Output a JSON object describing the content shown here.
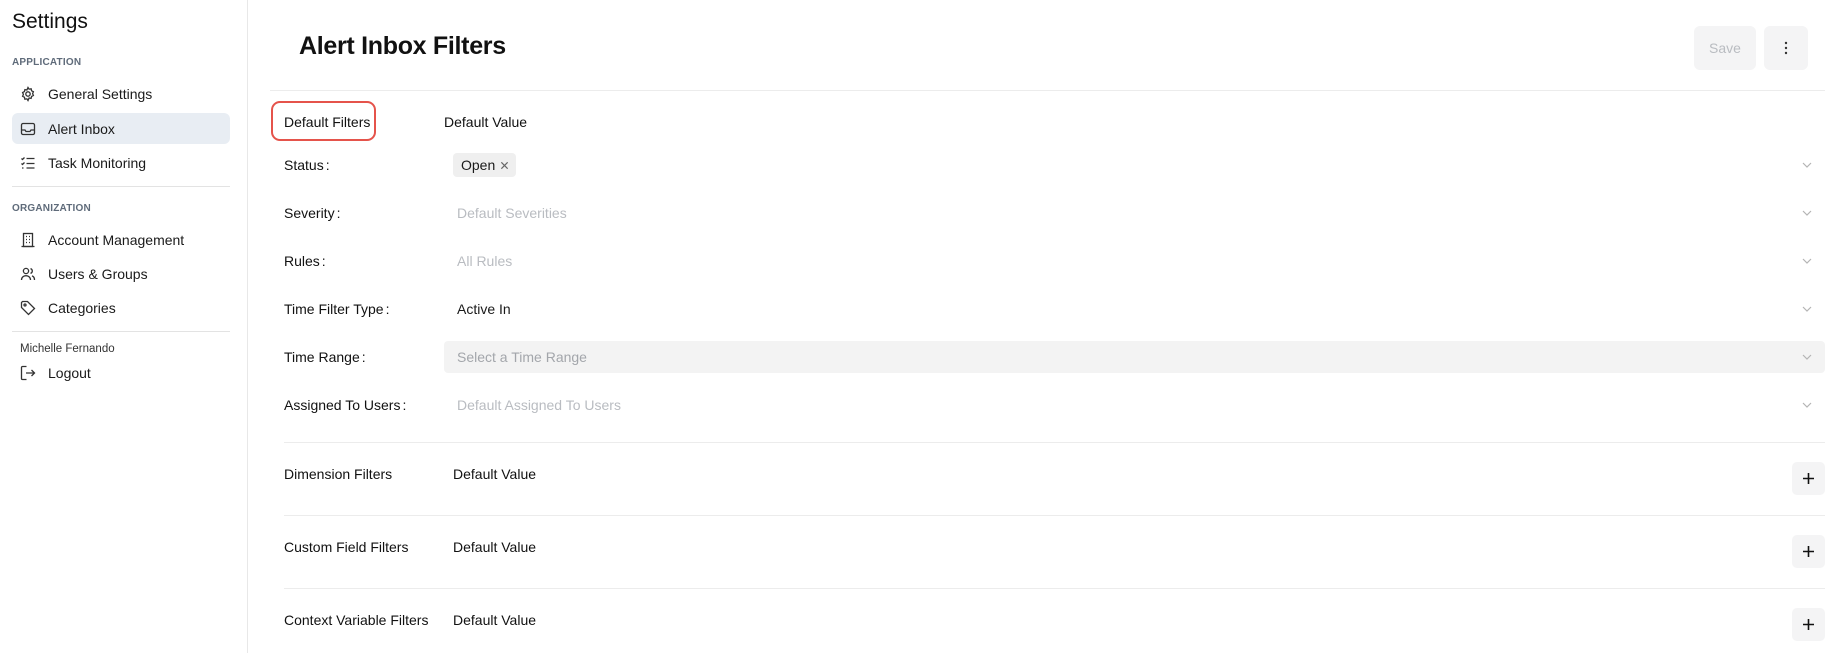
{
  "sidebar": {
    "title": "Settings",
    "sections": [
      {
        "label": "APPLICATION"
      },
      {
        "label": "ORGANIZATION"
      }
    ],
    "application_items": [
      {
        "label": "General Settings",
        "icon": "gear-icon"
      },
      {
        "label": "Alert Inbox",
        "icon": "inbox-icon",
        "active": true
      },
      {
        "label": "Task Monitoring",
        "icon": "list-check-icon"
      }
    ],
    "organization_items": [
      {
        "label": "Account Management",
        "icon": "building-icon"
      },
      {
        "label": "Users & Groups",
        "icon": "users-icon"
      },
      {
        "label": "Categories",
        "icon": "tag-icon"
      }
    ],
    "user_name": "Michelle Fernando",
    "logout_label": "Logout"
  },
  "header": {
    "title": "Alert Inbox Filters",
    "save_label": "Save"
  },
  "default_filters": {
    "heading": "Default Filters",
    "value_heading": "Default Value",
    "rows": [
      {
        "label": "Status",
        "tag": "Open"
      },
      {
        "label": "Severity",
        "placeholder": "Default Severities"
      },
      {
        "label": "Rules",
        "placeholder": "All Rules"
      },
      {
        "label": "Time Filter Type",
        "value": "Active In"
      },
      {
        "label": "Time Range",
        "placeholder": "Select a Time Range",
        "disabled": true
      },
      {
        "label": "Assigned To Users",
        "placeholder": "Default Assigned To Users"
      }
    ]
  },
  "sections": [
    {
      "label": "Dimension Filters",
      "value_heading": "Default Value"
    },
    {
      "label": "Custom Field Filters",
      "value_heading": "Default Value"
    },
    {
      "label": "Context Variable Filters",
      "value_heading": "Default Value"
    }
  ],
  "colors": {
    "highlight": "#e5534b",
    "active_nav": "#e8edf3",
    "placeholder": "#b9bcc1"
  }
}
